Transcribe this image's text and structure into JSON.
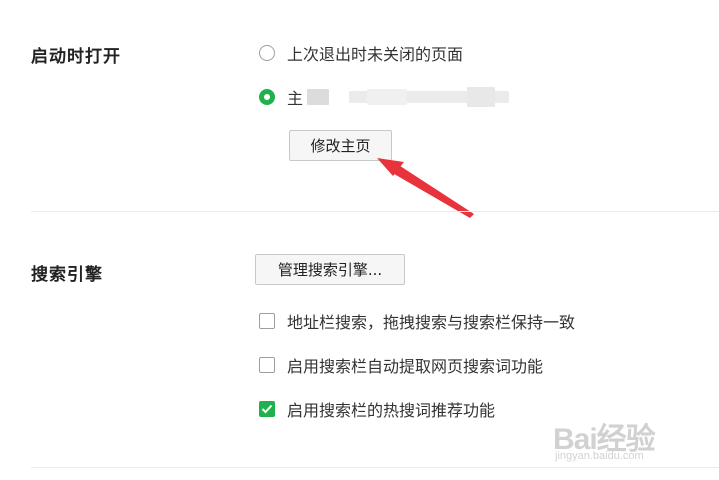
{
  "startup": {
    "title": "启动时打开",
    "option_restore": "上次退出时未关闭的页面",
    "option_homepage_visible": "主",
    "homepage_blurred": true,
    "modify_button": "修改主页"
  },
  "search_engine": {
    "title": "搜索引擎",
    "manage_button": "管理搜索引擎...",
    "options": [
      {
        "label": "地址栏搜索，拖拽搜索与搜索栏保持一致",
        "checked": false
      },
      {
        "label": "启用搜索栏自动提取网页搜索词功能",
        "checked": false
      },
      {
        "label": "启用搜索栏的热搜词推荐功能",
        "checked": true
      }
    ]
  },
  "colors": {
    "accent_green": "#20b04d",
    "annotation_arrow": "#e8333c"
  },
  "watermark": {
    "brand": "Bai经验",
    "url": "jingyan.baidu.com"
  }
}
